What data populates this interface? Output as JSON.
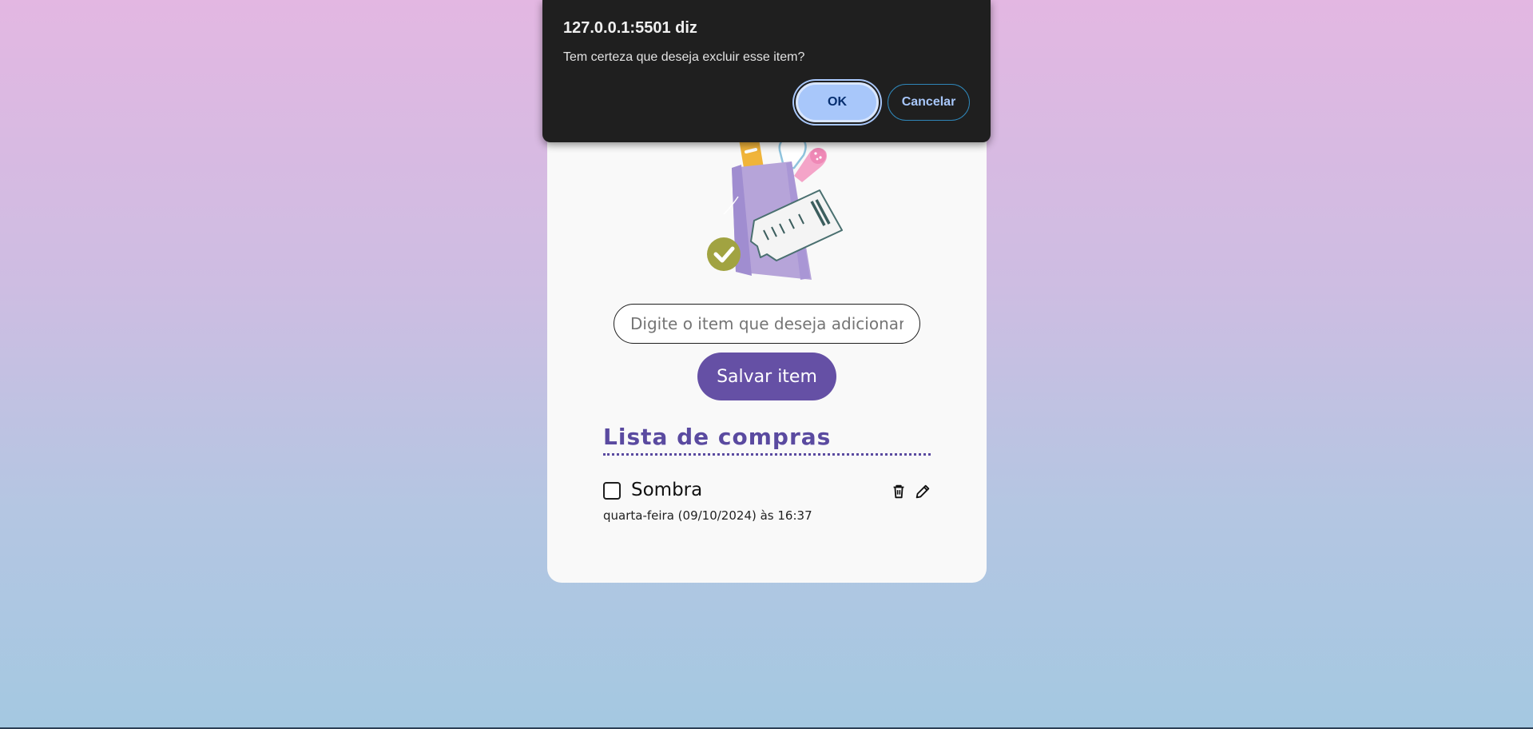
{
  "dialog": {
    "title": "127.0.0.1:5501 diz",
    "message": "Tem certeza que deseja excluir esse item?",
    "ok_label": "OK",
    "cancel_label": "Cancelar"
  },
  "form": {
    "input_placeholder": "Digite o item que deseja adicionar",
    "input_value": "",
    "save_label": "Salvar item"
  },
  "list": {
    "title": "Lista de compras",
    "items": [
      {
        "name": "Sombra",
        "date": "quarta-feira (09/10/2024) às 16:37",
        "checked": false
      }
    ]
  },
  "icons": [
    "trash-icon",
    "pencil-icon",
    "check-badge-icon",
    "grocery-bag-illustration"
  ],
  "colors": {
    "accent": "#6550a5",
    "title": "#5a4aa0",
    "dialog_bg": "#1f1f1f",
    "ok_button": "#a8c7fa"
  }
}
